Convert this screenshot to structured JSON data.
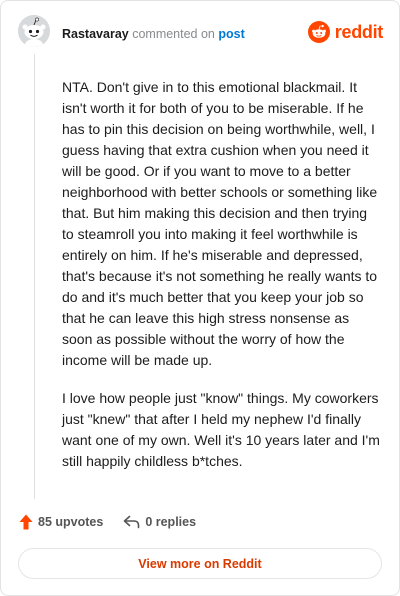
{
  "header": {
    "author": "Rastavaray",
    "action_text": "commented on",
    "post_link": "post",
    "brand": "reddit"
  },
  "comment": {
    "paragraphs": [
      "NTA. Don't give in to this emotional blackmail. It isn't worth it for both of you to be miserable. If he has to pin this decision on being worthwhile, well, I guess having that extra cushion when you need it will be good. Or if you want to move to a better neighborhood with better schools or something like that. But him making this decision and then trying to steamroll you into making it feel worthwhile is entirely on him. If he's miserable and depressed, that's because it's not something he really wants to do and it's much better that you keep your job so that he can leave this high stress nonsense as soon as possible without the worry of how the income will be made up.",
      "I love how people just \"know\" things. My coworkers just \"knew\" that after I held my nephew I'd finally want one of my own. Well it's 10 years later and I'm still happily childless b*tches."
    ]
  },
  "actions": {
    "upvotes": "85 upvotes",
    "replies": "0 replies"
  },
  "view_more_label": "View more on Reddit",
  "colors": {
    "brand_orange": "#ff4500",
    "link_blue": "#0079d3",
    "cta_text": "#d93a00"
  },
  "icons": {
    "avatar": "snoo-avatar-icon",
    "brand": "reddit-logo-icon",
    "upvote": "upvote-arrow-icon",
    "reply": "reply-arrow-icon"
  }
}
